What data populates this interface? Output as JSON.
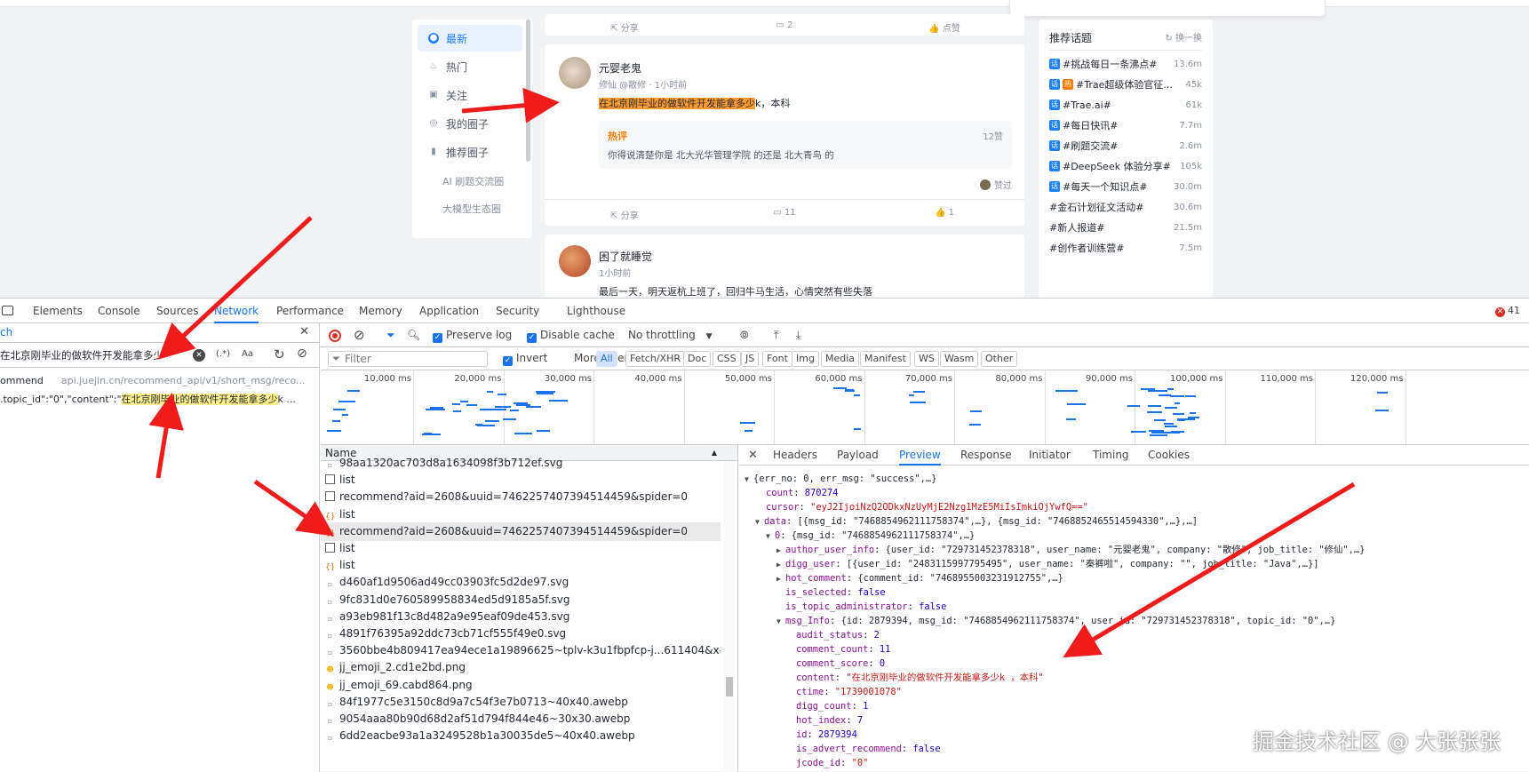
{
  "site": {
    "nav": [
      {
        "label": "最新",
        "icon": "latest-icon",
        "active": true
      },
      {
        "label": "热门",
        "icon": "fire-icon",
        "active": false
      },
      {
        "label": "关注",
        "icon": "follow-icon",
        "active": false
      },
      {
        "label": "我的圈子",
        "icon": "circle-icon",
        "active": false
      },
      {
        "label": "推荐圈子",
        "icon": "bookmark-icon",
        "active": false
      }
    ],
    "nav_sub": [
      "AI 刷题交流圈",
      "大模型生态圈"
    ],
    "prev_actions": [
      "分享",
      "2",
      "点赞"
    ],
    "post1": {
      "author": "元婴老鬼",
      "meta": "修仙 @散修 · 1小时前",
      "content_highlight": "在北京刚毕业的做软件开发能拿多少",
      "content_rest": "k，本科",
      "hot_label": "热评",
      "hot_likes": "12赞",
      "hot_text": "你得说清楚你是 北大光华管理学院 的还是 北大青鸟 的",
      "liked_by": "赞过",
      "actions": [
        "分享",
        "11",
        "1"
      ]
    },
    "post2": {
      "author": "困了就睡觉",
      "meta": "1小时前",
      "content": "最后一天，明天返杭上班了，回归牛马生活，心情突然有些失落"
    },
    "sidebar": {
      "title": "推荐话题",
      "refresh": "换一换",
      "topics": [
        {
          "name": "#挑战每日一条沸点#",
          "count": "13.6m",
          "fire": false
        },
        {
          "name": "#Trae超级体验官征...",
          "count": "45k",
          "fire": true
        },
        {
          "name": "#Trae.ai#",
          "count": "61k",
          "fire": false
        },
        {
          "name": "#每日快讯#",
          "count": "7.7m",
          "fire": false
        },
        {
          "name": "#刷题交流#",
          "count": "2.6m",
          "fire": false
        },
        {
          "name": "#DeepSeek 体验分享#",
          "count": "105k",
          "fire": false
        },
        {
          "name": "#每天一个知识点#",
          "count": "30.0m",
          "fire": false
        },
        {
          "name": "#金石计划征文活动#",
          "count": "30.6m",
          "fire": false
        },
        {
          "name": "#新人报道#",
          "count": "21.5m",
          "fire": false
        },
        {
          "name": "#创作者训练营#",
          "count": "7.5m",
          "fire": false
        }
      ]
    }
  },
  "devtools": {
    "tabs": [
      "Elements",
      "Console",
      "Sources",
      "Network",
      "Performance",
      "Memory",
      "Application",
      "Security",
      "Lighthouse"
    ],
    "active_tab": "Network",
    "errors": "41",
    "search": {
      "header": "ch",
      "query": "在北京刚毕业的做软件开发能拿多少",
      "regex_btn": "(.*)",
      "case_btn": "Aa",
      "result_file": "ommend",
      "result_url": "api.juejin.cn/recommend_api/v1/short_msg/reco...",
      "result_prefix": ".topic_id\":\"0\",\"content\":\"",
      "result_match": "在北京刚毕业的做软件开发能拿多少",
      "result_suffix": "k ..."
    },
    "toolbar": {
      "preserve_log": "Preserve log",
      "disable_cache": "Disable cache",
      "throttling": "No throttling"
    },
    "filterbar": {
      "placeholder": "Filter",
      "invert": "Invert",
      "more_filters": "More filters",
      "types": [
        "All",
        "Fetch/XHR",
        "Doc",
        "CSS",
        "JS",
        "Font",
        "Img",
        "Media",
        "Manifest",
        "WS",
        "Wasm",
        "Other"
      ]
    },
    "timeline_ticks": [
      "10,000 ms",
      "20,000 ms",
      "30,000 ms",
      "40,000 ms",
      "50,000 ms",
      "60,000 ms",
      "70,000 ms",
      "80,000 ms",
      "90,000 ms",
      "100,000 ms",
      "110,000 ms",
      "120,000 ms"
    ],
    "requests_header": "Name",
    "requests": [
      {
        "name": "98aa1320ac703d8a1634098f3b712ef.svg",
        "icon": "img"
      },
      {
        "name": "list",
        "icon": "doc"
      },
      {
        "name": "recommend?aid=2608&uuid=7462257407394514459&spider=0",
        "icon": "doc"
      },
      {
        "name": "list",
        "icon": "xhr"
      },
      {
        "name": "recommend?aid=2608&uuid=7462257407394514459&spider=0",
        "icon": "xhr",
        "selected": true
      },
      {
        "name": "list",
        "icon": "doc"
      },
      {
        "name": "list",
        "icon": "xhr"
      },
      {
        "name": "d460af1d9506ad49cc03903fc5d2de97.svg",
        "icon": "img"
      },
      {
        "name": "9fc831d0e760589958834ed5d9185a5f.svg",
        "icon": "img"
      },
      {
        "name": "a93eb981f13c8d482a9e95eaf09de453.svg",
        "icon": "img"
      },
      {
        "name": "4891f76395a92ddc73cb71cf555f49e0.svg",
        "icon": "img"
      },
      {
        "name": "3560bbe4b809417ea94ece1a19896625~tplv-k3u1fbpfcp-j...611404&x-si...",
        "icon": "img"
      },
      {
        "name": "jj_emoji_2.cd1e2bd.png",
        "icon": "emoji"
      },
      {
        "name": "jj_emoji_69.cabd864.png",
        "icon": "emoji"
      },
      {
        "name": "84f1977c5e3150c8d9a7c54f3e7b0713~40x40.awebp",
        "icon": "img"
      },
      {
        "name": "9054aaa80b90d68d2af51d794f844e46~30x30.awebp",
        "icon": "img"
      },
      {
        "name": "6dd2eacbe93a1a3249528b1a30035de5~40x40.awebp",
        "icon": "img"
      }
    ],
    "preview_tabs": [
      "Headers",
      "Payload",
      "Preview",
      "Response",
      "Initiator",
      "Timing",
      "Cookies"
    ],
    "active_preview_tab": "Preview",
    "json": {
      "root": "{err_no: 0, err_msg: \"success\",…}",
      "count_key": "count",
      "count_val": "870274",
      "cursor_key": "cursor",
      "cursor_val": "\"eyJ2IjoiNzQ2ODkxNzUyMjE2Nzg1MzE5MiIsImkiOjYwfQ==\"",
      "data_key": "data",
      "data_val": "[{msg_id: \"7468854962111758374\",…}, {msg_id: \"7468852465514594330\",…},…]",
      "item0_key": "0",
      "item0_val": "{msg_id: \"7468854962111758374\",…}",
      "author_key": "author_user_info",
      "author_val": "{user_id: \"729731452378318\", user_name: \"元婴老鬼\", company: \"散修\", job_title: \"修仙\",…}",
      "digg_key": "digg_user",
      "digg_val": "[{user_id: \"2483115997795495\", user_name: \"秦裤啦\", company: \"\", job_title: \"Java\",…}]",
      "hot_key": "hot_comment",
      "hot_val": "{comment_id: \"7468955003231912755\",…}",
      "sel_key": "is_selected",
      "sel_val": "false",
      "admin_key": "is_topic_administrator",
      "admin_val": "false",
      "info_key": "msg_Info",
      "info_val": "{id: 2879394, msg_id: \"7468854962111758374\", user_id: \"729731452378318\", topic_id: \"0\",…}",
      "audit_key": "audit_status",
      "audit_val": "2",
      "cc_key": "comment_count",
      "cc_val": "11",
      "cs_key": "comment_score",
      "cs_val": "0",
      "content_key": "content",
      "content_val": "\"在北京刚毕业的做软件开发能拿多少k ，本科\"",
      "ctime_key": "ctime",
      "ctime_val": "\"1739001078\"",
      "digg_count_key": "digg_count",
      "digg_count_val": "1",
      "hot_index_key": "hot_index",
      "hot_index_val": "7",
      "id_key": "id",
      "id_val": "2879394",
      "advert_key": "is_advert_recommend",
      "advert_val": "false",
      "jcode_key": "jcode_id",
      "jcode_val": "\"0\""
    }
  },
  "watermark": "掘金技术社区 @ 大张张张",
  "colors": {
    "accent": "#1e80ff",
    "devtools_blue": "#1a73e8",
    "arrow_red": "#ee1c1c",
    "highlight_yellow": "#fdf08b",
    "highlight_orange": "#ff9a2e"
  }
}
